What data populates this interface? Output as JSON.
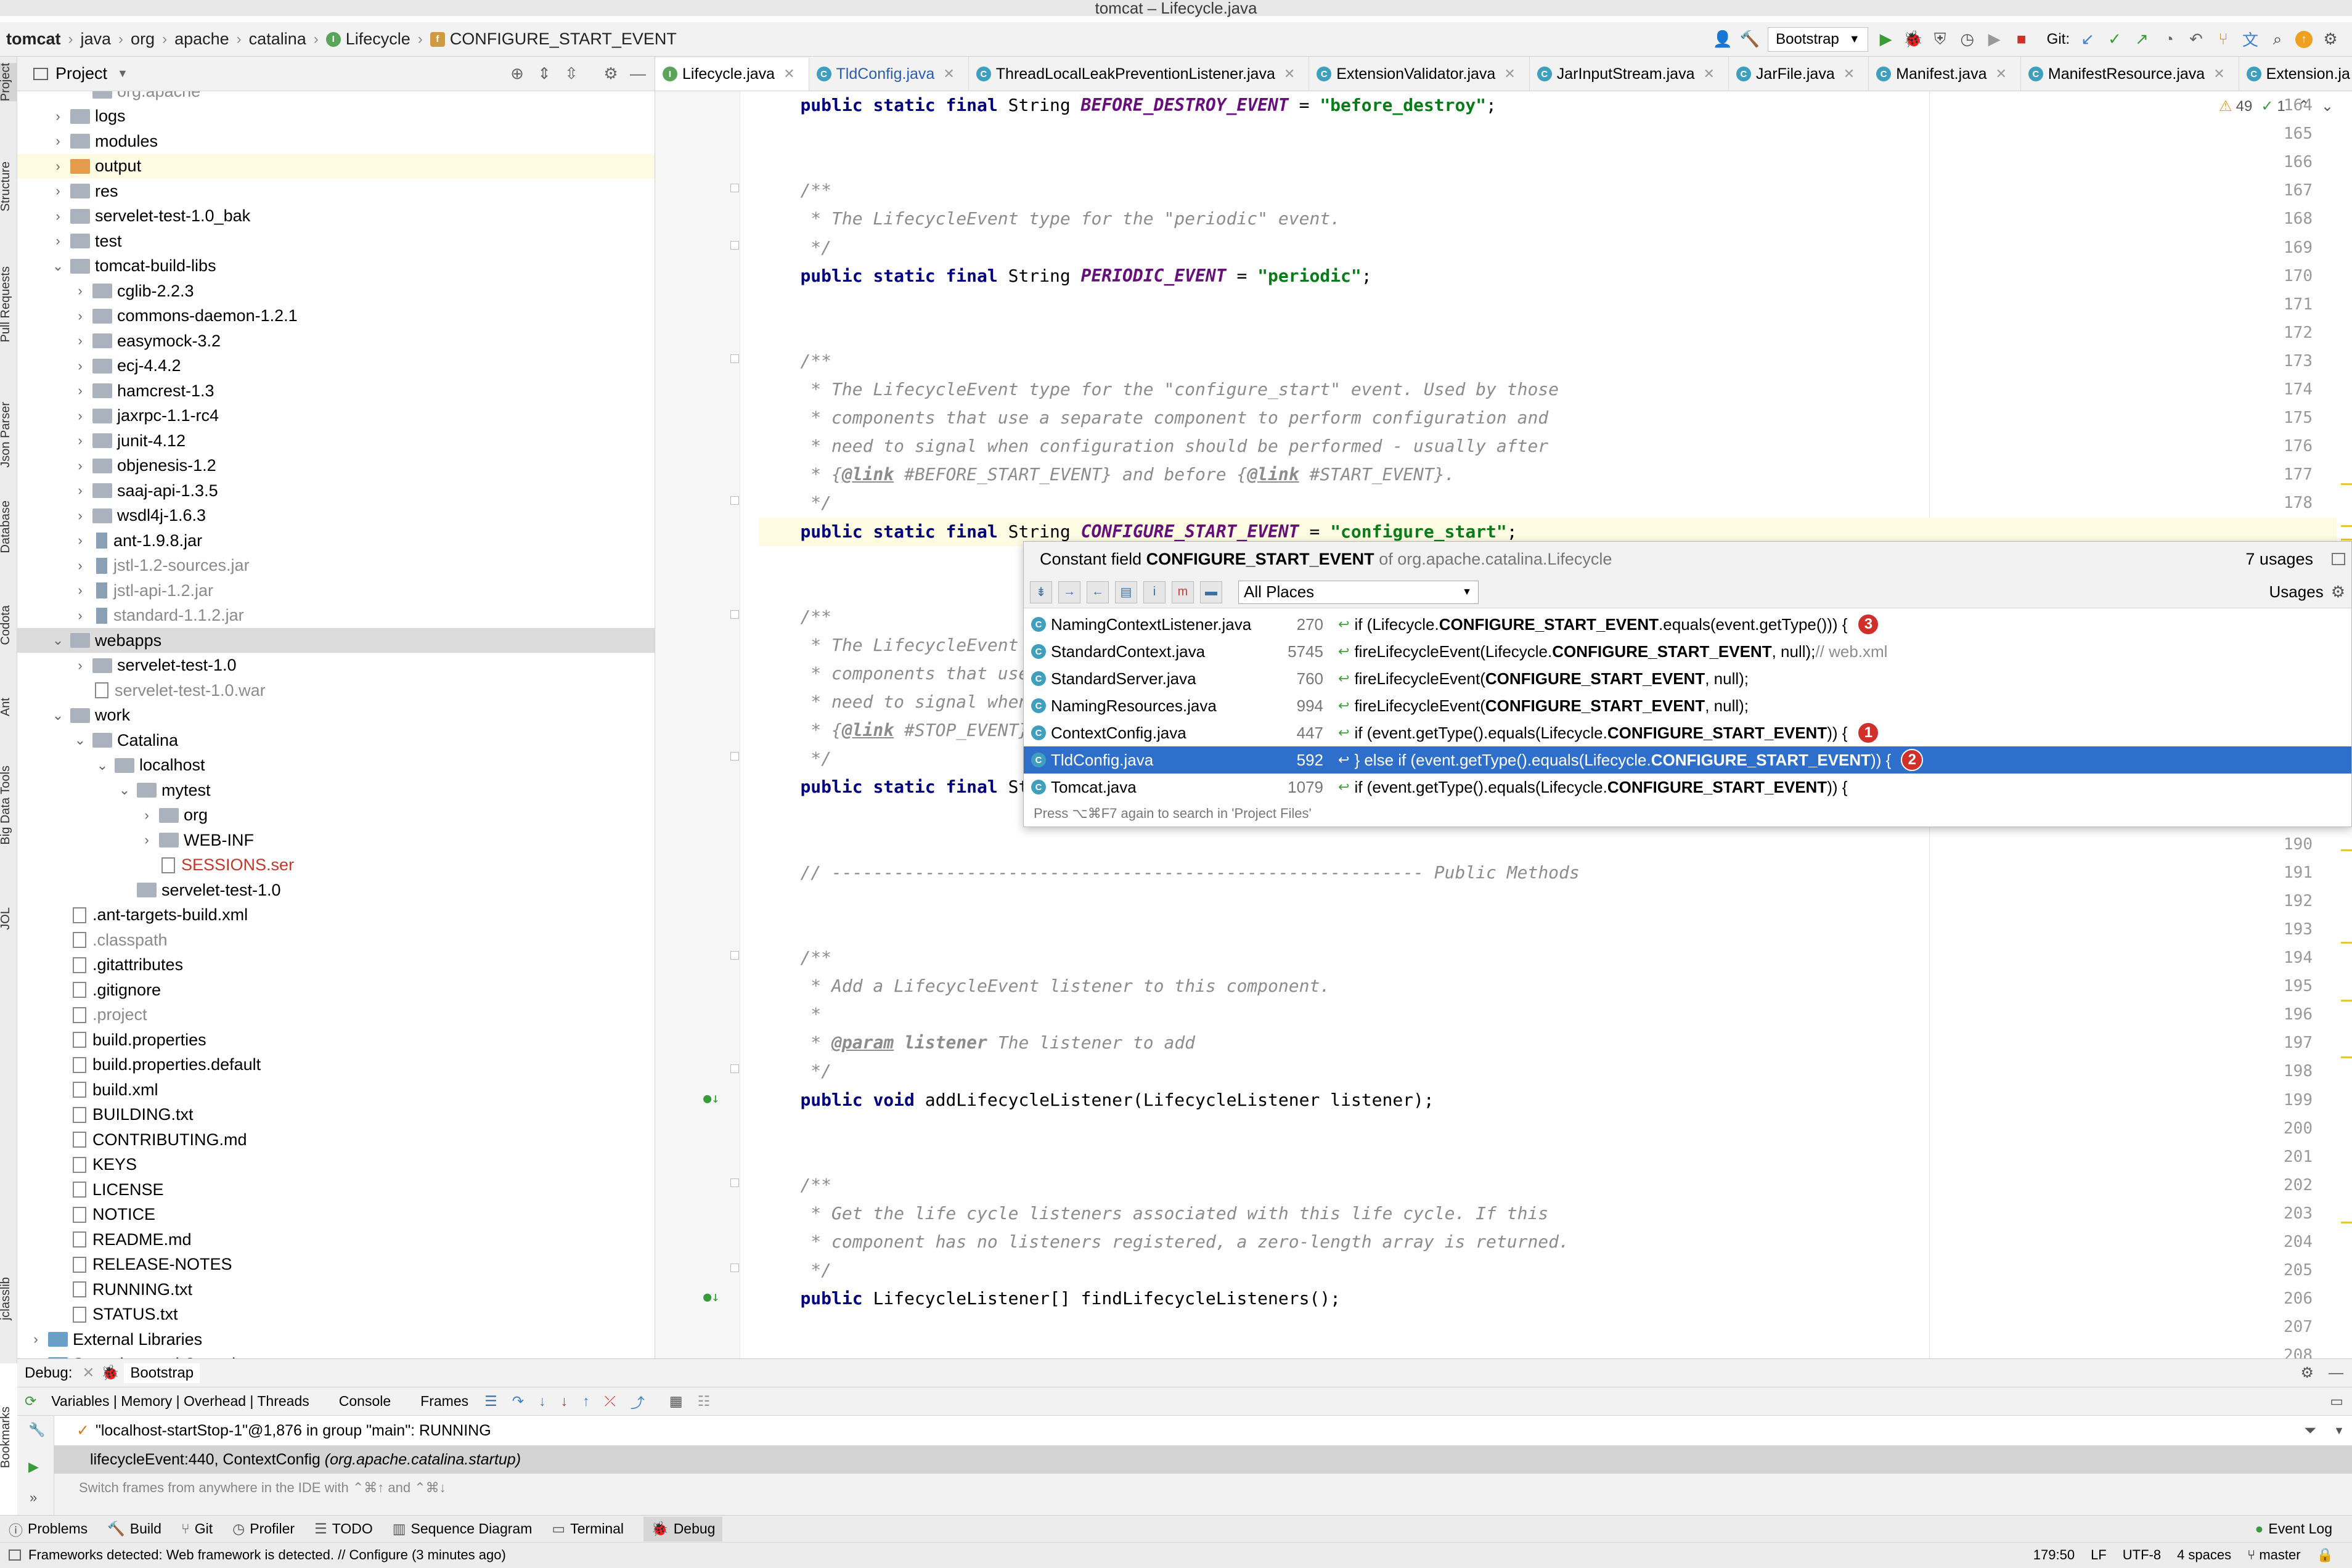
{
  "window_title": "tomcat – Lifecycle.java",
  "breadcrumb": [
    "tomcat",
    "java",
    "org",
    "apache",
    "catalina",
    "Lifecycle",
    "CONFIGURE_START_EVENT"
  ],
  "toolbar": {
    "run_config": "Bootstrap",
    "git_label": "Git:"
  },
  "left_strip": [
    "Project",
    "Structure",
    "Pull Requests",
    "Json Parser",
    "Database",
    "Codota",
    "Ant",
    "Big Data Tools",
    "JOL",
    "jclasslib",
    "Bookmarks"
  ],
  "project_panel": {
    "title": "Project"
  },
  "tree": [
    {
      "label": "org.apache",
      "indent": 2,
      "type": "folder",
      "state": "none",
      "style": "gray"
    },
    {
      "label": "logs",
      "indent": 1,
      "type": "folder",
      "state": "closed"
    },
    {
      "label": "modules",
      "indent": 1,
      "type": "folder",
      "state": "closed"
    },
    {
      "label": "output",
      "indent": 1,
      "type": "folder-orange",
      "state": "closed",
      "highlight": "yellow"
    },
    {
      "label": "res",
      "indent": 1,
      "type": "folder",
      "state": "closed"
    },
    {
      "label": "servelet-test-1.0_bak",
      "indent": 1,
      "type": "folder",
      "state": "closed"
    },
    {
      "label": "test",
      "indent": 1,
      "type": "folder",
      "state": "closed"
    },
    {
      "label": "tomcat-build-libs",
      "indent": 1,
      "type": "folder",
      "state": "open"
    },
    {
      "label": "cglib-2.2.3",
      "indent": 2,
      "type": "folder",
      "state": "closed"
    },
    {
      "label": "commons-daemon-1.2.1",
      "indent": 2,
      "type": "folder",
      "state": "closed"
    },
    {
      "label": "easymock-3.2",
      "indent": 2,
      "type": "folder",
      "state": "closed"
    },
    {
      "label": "ecj-4.4.2",
      "indent": 2,
      "type": "folder",
      "state": "closed"
    },
    {
      "label": "hamcrest-1.3",
      "indent": 2,
      "type": "folder",
      "state": "closed"
    },
    {
      "label": "jaxrpc-1.1-rc4",
      "indent": 2,
      "type": "folder",
      "state": "closed"
    },
    {
      "label": "junit-4.12",
      "indent": 2,
      "type": "folder",
      "state": "closed"
    },
    {
      "label": "objenesis-1.2",
      "indent": 2,
      "type": "folder",
      "state": "closed"
    },
    {
      "label": "saaj-api-1.3.5",
      "indent": 2,
      "type": "folder",
      "state": "closed"
    },
    {
      "label": "wsdl4j-1.6.3",
      "indent": 2,
      "type": "folder",
      "state": "closed"
    },
    {
      "label": "ant-1.9.8.jar",
      "indent": 2,
      "type": "jar",
      "state": "closed"
    },
    {
      "label": "jstl-1.2-sources.jar",
      "indent": 2,
      "type": "jar",
      "state": "closed",
      "style": "gray"
    },
    {
      "label": "jstl-api-1.2.jar",
      "indent": 2,
      "type": "jar",
      "state": "closed",
      "style": "gray"
    },
    {
      "label": "standard-1.1.2.jar",
      "indent": 2,
      "type": "jar",
      "state": "closed",
      "style": "gray"
    },
    {
      "label": "webapps",
      "indent": 1,
      "type": "folder",
      "state": "open",
      "highlight": "gray"
    },
    {
      "label": "servelet-test-1.0",
      "indent": 2,
      "type": "folder",
      "state": "closed"
    },
    {
      "label": "servelet-test-1.0.war",
      "indent": 2,
      "type": "file",
      "state": "none",
      "style": "gray"
    },
    {
      "label": "work",
      "indent": 1,
      "type": "folder",
      "state": "open"
    },
    {
      "label": "Catalina",
      "indent": 2,
      "type": "folder",
      "state": "open"
    },
    {
      "label": "localhost",
      "indent": 3,
      "type": "folder",
      "state": "open"
    },
    {
      "label": "mytest",
      "indent": 4,
      "type": "folder",
      "state": "open"
    },
    {
      "label": "org",
      "indent": 5,
      "type": "folder",
      "state": "closed"
    },
    {
      "label": "WEB-INF",
      "indent": 5,
      "type": "folder",
      "state": "closed"
    },
    {
      "label": "SESSIONS.ser",
      "indent": 5,
      "type": "file",
      "state": "none",
      "style": "red"
    },
    {
      "label": "servelet-test-1.0",
      "indent": 4,
      "type": "folder",
      "state": "none"
    },
    {
      "label": ".ant-targets-build.xml",
      "indent": 1,
      "type": "file",
      "state": "none"
    },
    {
      "label": ".classpath",
      "indent": 1,
      "type": "file",
      "state": "none",
      "style": "gray"
    },
    {
      "label": ".gitattributes",
      "indent": 1,
      "type": "file",
      "state": "none"
    },
    {
      "label": ".gitignore",
      "indent": 1,
      "type": "file",
      "state": "none"
    },
    {
      "label": ".project",
      "indent": 1,
      "type": "file",
      "state": "none",
      "style": "gray"
    },
    {
      "label": "build.properties",
      "indent": 1,
      "type": "file",
      "state": "none"
    },
    {
      "label": "build.properties.default",
      "indent": 1,
      "type": "file",
      "state": "none"
    },
    {
      "label": "build.xml",
      "indent": 1,
      "type": "file",
      "state": "none"
    },
    {
      "label": "BUILDING.txt",
      "indent": 1,
      "type": "file",
      "state": "none"
    },
    {
      "label": "CONTRIBUTING.md",
      "indent": 1,
      "type": "file",
      "state": "none"
    },
    {
      "label": "KEYS",
      "indent": 1,
      "type": "file",
      "state": "none"
    },
    {
      "label": "LICENSE",
      "indent": 1,
      "type": "file",
      "state": "none"
    },
    {
      "label": "NOTICE",
      "indent": 1,
      "type": "file",
      "state": "none"
    },
    {
      "label": "README.md",
      "indent": 1,
      "type": "file",
      "state": "none"
    },
    {
      "label": "RELEASE-NOTES",
      "indent": 1,
      "type": "file",
      "state": "none"
    },
    {
      "label": "RUNNING.txt",
      "indent": 1,
      "type": "file",
      "state": "none"
    },
    {
      "label": "STATUS.txt",
      "indent": 1,
      "type": "file",
      "state": "none"
    },
    {
      "label": "External Libraries",
      "indent": 0,
      "type": "lib",
      "state": "closed"
    },
    {
      "label": "Scratches and Consoles",
      "indent": 0,
      "type": "lib",
      "state": "closed"
    }
  ],
  "tabs": [
    {
      "label": "Lifecycle.java",
      "icon": "i",
      "active": true
    },
    {
      "label": "TldConfig.java",
      "icon": "c",
      "active": false,
      "blue": true
    },
    {
      "label": "ThreadLocalLeakPreventionListener.java",
      "icon": "c",
      "active": false
    },
    {
      "label": "ExtensionValidator.java",
      "icon": "c",
      "active": false
    },
    {
      "label": "JarInputStream.java",
      "icon": "c",
      "active": false
    },
    {
      "label": "JarFile.java",
      "icon": "c",
      "active": false
    },
    {
      "label": "Manifest.java",
      "icon": "c",
      "active": false
    },
    {
      "label": "ManifestResource.java",
      "icon": "c",
      "active": false
    },
    {
      "label": "Extension.ja",
      "icon": "c",
      "active": false
    }
  ],
  "inspection": {
    "warnings": "49",
    "ok": "1"
  },
  "code_lines": [
    {
      "n": "164",
      "html": "    <span class='kw'>public static final</span> String <span class='cst'>BEFORE_DESTROY_EVENT</span> = <span class='str'>\"before_destroy\"</span>;"
    },
    {
      "n": "165",
      "html": ""
    },
    {
      "n": "166",
      "html": ""
    },
    {
      "n": "167",
      "html": "    <span class='cmt'>/**</span>"
    },
    {
      "n": "168",
      "html": "<span class='cmt'>     * The LifecycleEvent type for the \"periodic\" event.</span>"
    },
    {
      "n": "169",
      "html": "<span class='cmt'>     */</span>"
    },
    {
      "n": "170",
      "html": "    <span class='kw'>public static final</span> String <span class='cst'>PERIODIC_EVENT</span> = <span class='str'>\"periodic\"</span>;"
    },
    {
      "n": "171",
      "html": ""
    },
    {
      "n": "172",
      "html": ""
    },
    {
      "n": "173",
      "html": "    <span class='cmt'>/**</span>"
    },
    {
      "n": "174",
      "html": "<span class='cmt'>     * The LifecycleEvent type for the \"configure_start\" event. Used by those</span>"
    },
    {
      "n": "175",
      "html": "<span class='cmt'>     * components that use a separate component to perform configuration and</span>"
    },
    {
      "n": "176",
      "html": "<span class='cmt'>     * need to signal when configuration should be performed - usually after</span>"
    },
    {
      "n": "177",
      "html": "<span class='cmt'>     * {</span><span class='tag'>@link</span><span class='cmt'> #BEFORE_START_EVENT} and before {</span><span class='tag'>@link</span><span class='cmt'> #START_EVENT}.</span>"
    },
    {
      "n": "178",
      "html": "<span class='cmt'>     */</span>"
    },
    {
      "n": "179",
      "html": "    <span class='kw'>public static final</span> String <span class='cst'>CONFIGURE_START_EVENT</span> = <span class='str'>\"configure_start\"</span>;"
    },
    {
      "n": "180",
      "html": ""
    },
    {
      "n": "181",
      "html": ""
    },
    {
      "n": "182",
      "html": "    <span class='cmt'>/**</span>"
    },
    {
      "n": "183",
      "html": "<span class='cmt'>     * The LifecycleEvent typ</span>"
    },
    {
      "n": "184",
      "html": "<span class='cmt'>     * components that use a</span>"
    },
    {
      "n": "185",
      "html": "<span class='cmt'>     * need to signal when de</span>"
    },
    {
      "n": "186",
      "html": "<span class='cmt'>     * {</span><span class='tag'>@link</span><span class='cmt'> #STOP_EVENT} a</span>"
    },
    {
      "n": "187",
      "html": "<span class='cmt'>     */</span>"
    },
    {
      "n": "188",
      "html": "    <span class='kw'>public static final</span> Stri"
    },
    {
      "n": "189",
      "html": ""
    },
    {
      "n": "190",
      "html": ""
    },
    {
      "n": "191",
      "html": "    <span class='cmt'>// --------------------------------------------------------- Public Methods</span>"
    },
    {
      "n": "192",
      "html": ""
    },
    {
      "n": "193",
      "html": ""
    },
    {
      "n": "194",
      "html": "    <span class='cmt'>/**</span>"
    },
    {
      "n": "195",
      "html": "<span class='cmt'>     * Add a LifecycleEvent listener to this component.</span>"
    },
    {
      "n": "196",
      "html": "<span class='cmt'>     *</span>"
    },
    {
      "n": "197",
      "html": "<span class='cmt'>     * </span><span class='tag'>@param</span> <span class='cmt' style='font-weight:bold'>listener</span><span class='cmt'> The listener to add</span>"
    },
    {
      "n": "198",
      "html": "<span class='cmt'>     */</span>"
    },
    {
      "n": "199",
      "html": "    <span class='kw'>public void</span> addLifecycleListener(LifecycleListener listener);"
    },
    {
      "n": "200",
      "html": ""
    },
    {
      "n": "201",
      "html": ""
    },
    {
      "n": "202",
      "html": "    <span class='cmt'>/**</span>"
    },
    {
      "n": "203",
      "html": "<span class='cmt'>     * Get the life cycle listeners associated with this life cycle. If this</span>"
    },
    {
      "n": "204",
      "html": "<span class='cmt'>     * component has no listeners registered, a zero-length array is returned.</span>"
    },
    {
      "n": "205",
      "html": "<span class='cmt'>     */</span>"
    },
    {
      "n": "206",
      "html": "    <span class='kw'>public</span> LifecycleListener[] findLifecycleListeners();"
    },
    {
      "n": "207",
      "html": ""
    },
    {
      "n": "208",
      "html": ""
    }
  ],
  "popup": {
    "prefix": "Constant field",
    "field": "CONFIGURE_START_EVENT",
    "of": "of org.apache.catalina.Lifecycle",
    "count": "7 usages",
    "scope": "All Places",
    "usages_label": "Usages",
    "footer": "Press ⌥⌘F7 again to search in 'Project Files'",
    "rows": [
      {
        "file": "NamingContextListener.java",
        "line": "270",
        "pre": "if (Lifecycle.",
        "bold": "CONFIGURE_START_EVENT",
        "post": ".equals(event.getType())) {",
        "comment": "",
        "badge": "3",
        "selected": false
      },
      {
        "file": "StandardContext.java",
        "line": "5745",
        "pre": "fireLifecycleEvent(Lifecycle.",
        "bold": "CONFIGURE_START_EVENT",
        "post": ", null);",
        "comment": "  // web.xml",
        "badge": "",
        "selected": false
      },
      {
        "file": "StandardServer.java",
        "line": "760",
        "pre": "fireLifecycleEvent(",
        "bold": "CONFIGURE_START_EVENT",
        "post": ", null);",
        "comment": "",
        "badge": "",
        "selected": false
      },
      {
        "file": "NamingResources.java",
        "line": "994",
        "pre": "fireLifecycleEvent(",
        "bold": "CONFIGURE_START_EVENT",
        "post": ", null);",
        "comment": "",
        "badge": "",
        "selected": false
      },
      {
        "file": "ContextConfig.java",
        "line": "447",
        "pre": "if (event.getType().equals(Lifecycle.",
        "bold": "CONFIGURE_START_EVENT",
        "post": ")) {",
        "comment": "",
        "badge": "1",
        "selected": false
      },
      {
        "file": "TldConfig.java",
        "line": "592",
        "pre": "} else if (event.getType().equals(Lifecycle.",
        "bold": "CONFIGURE_START_EVENT",
        "post": ")) {",
        "comment": "",
        "badge": "2",
        "selected": true
      },
      {
        "file": "Tomcat.java",
        "line": "1079",
        "pre": "if (event.getType().equals(Lifecycle.",
        "bold": "CONFIGURE_START_EVENT",
        "post": ")) {",
        "comment": "",
        "badge": "",
        "selected": false
      }
    ]
  },
  "debug": {
    "label": "Debug:",
    "session": "Bootstrap",
    "tabs": [
      "Variables | Memory | Overhead | Threads",
      "Console",
      "Frames"
    ],
    "thread": "\"localhost-startStop-1\"@1,876 in group \"main\": RUNNING",
    "frame_method": "lifecycleEvent:440, ContextConfig",
    "frame_pkg": "(org.apache.catalina.startup)",
    "hint": "Switch frames from anywhere in the IDE with ⌃⌘↑ and ⌃⌘↓"
  },
  "bottom_tabs": [
    "Problems",
    "Build",
    "Git",
    "Profiler",
    "TODO",
    "Sequence Diagram",
    "Terminal",
    "Debug"
  ],
  "event_log": "Event Log",
  "status": {
    "message": "Frameworks detected: Web framework is detected. // Configure (3 minutes ago)",
    "position": "179:50",
    "line_sep": "LF",
    "encoding": "UTF-8",
    "indent": "4 spaces",
    "branch": "master"
  },
  "colors": {
    "accent": "#2e6fcb",
    "badge": "#d0302a",
    "keyword": "#000080",
    "constant": "#660e7a",
    "string": "#067d17"
  }
}
